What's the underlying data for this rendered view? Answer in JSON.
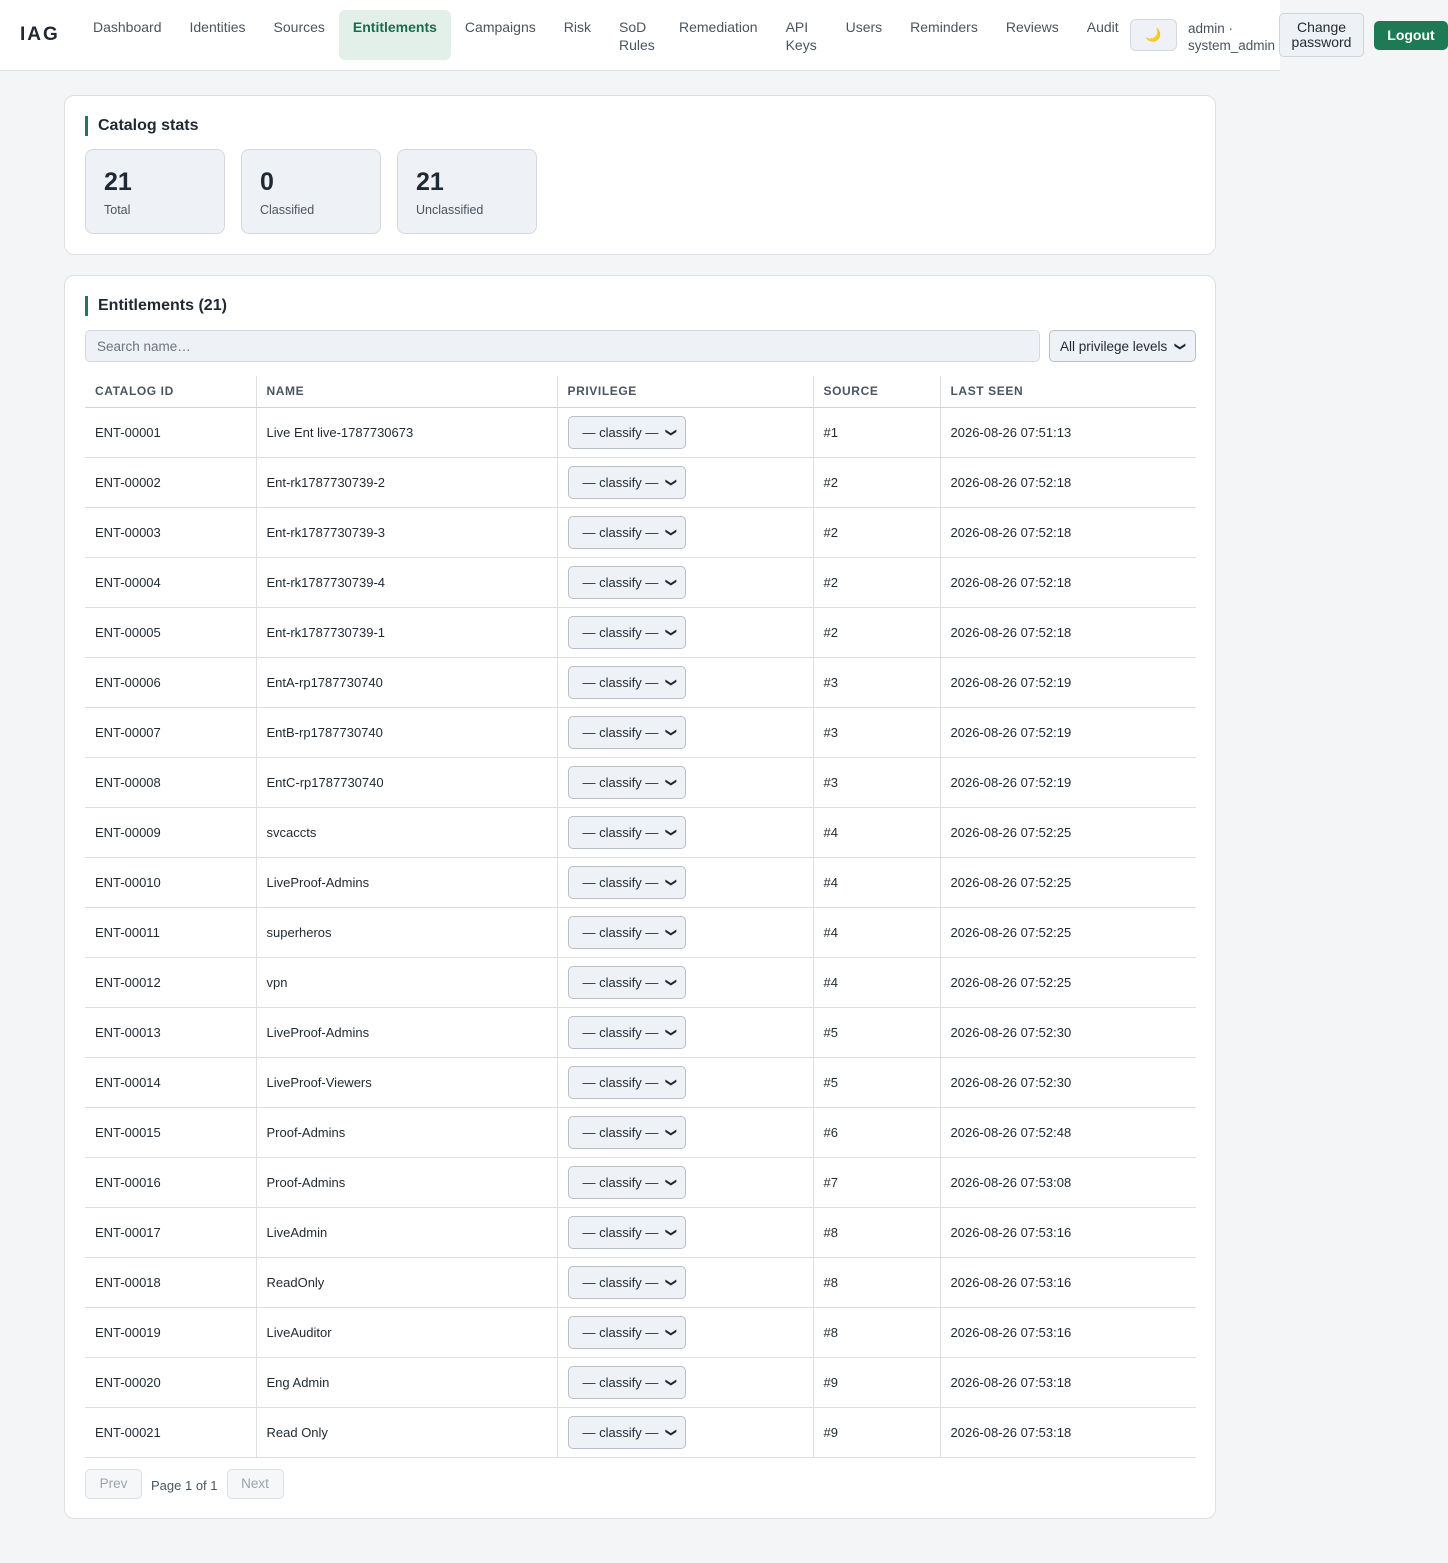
{
  "app": {
    "brand": "IAG"
  },
  "nav": [
    {
      "label": "Dashboard",
      "active": false
    },
    {
      "label": "Identities",
      "active": false
    },
    {
      "label": "Sources",
      "active": false
    },
    {
      "label": "Entitlements",
      "active": true
    },
    {
      "label": "Campaigns",
      "active": false
    },
    {
      "label": "Risk",
      "active": false
    },
    {
      "label": "SoD Rules",
      "active": false
    },
    {
      "label": "Remediation",
      "active": false
    },
    {
      "label": "API Keys",
      "active": false
    },
    {
      "label": "Users",
      "active": false
    },
    {
      "label": "Reminders",
      "active": false
    },
    {
      "label": "Reviews",
      "active": false
    },
    {
      "label": "Audit",
      "active": false
    }
  ],
  "header": {
    "theme_icon": "moon-icon",
    "theme_glyph": "🌙",
    "user": "admin · system_admin",
    "change_password": "Change password",
    "logout": "Logout"
  },
  "stats": {
    "title": "Catalog stats",
    "items": [
      {
        "value": "21",
        "label": "Total"
      },
      {
        "value": "0",
        "label": "Classified"
      },
      {
        "value": "21",
        "label": "Unclassified"
      }
    ]
  },
  "entitlements": {
    "title": "Entitlements (21)",
    "search_placeholder": "Search name…",
    "filter_value": "All privilege levels",
    "columns": [
      "CATALOG ID",
      "NAME",
      "PRIVILEGE",
      "SOURCE",
      "LAST SEEN"
    ],
    "rows": [
      {
        "id": "ENT-00001",
        "name": "Live Ent live-1787730673",
        "privilege": "— classify —",
        "source": "#1",
        "last_seen": "2026-08-26 07:51:13"
      },
      {
        "id": "ENT-00002",
        "name": "Ent-rk1787730739-2",
        "privilege": "— classify —",
        "source": "#2",
        "last_seen": "2026-08-26 07:52:18"
      },
      {
        "id": "ENT-00003",
        "name": "Ent-rk1787730739-3",
        "privilege": "— classify —",
        "source": "#2",
        "last_seen": "2026-08-26 07:52:18"
      },
      {
        "id": "ENT-00004",
        "name": "Ent-rk1787730739-4",
        "privilege": "— classify —",
        "source": "#2",
        "last_seen": "2026-08-26 07:52:18"
      },
      {
        "id": "ENT-00005",
        "name": "Ent-rk1787730739-1",
        "privilege": "— classify —",
        "source": "#2",
        "last_seen": "2026-08-26 07:52:18"
      },
      {
        "id": "ENT-00006",
        "name": "EntA-rp1787730740",
        "privilege": "— classify —",
        "source": "#3",
        "last_seen": "2026-08-26 07:52:19"
      },
      {
        "id": "ENT-00007",
        "name": "EntB-rp1787730740",
        "privilege": "— classify —",
        "source": "#3",
        "last_seen": "2026-08-26 07:52:19"
      },
      {
        "id": "ENT-00008",
        "name": "EntC-rp1787730740",
        "privilege": "— classify —",
        "source": "#3",
        "last_seen": "2026-08-26 07:52:19"
      },
      {
        "id": "ENT-00009",
        "name": "svcaccts",
        "privilege": "— classify —",
        "source": "#4",
        "last_seen": "2026-08-26 07:52:25"
      },
      {
        "id": "ENT-00010",
        "name": "LiveProof-Admins",
        "privilege": "— classify —",
        "source": "#4",
        "last_seen": "2026-08-26 07:52:25"
      },
      {
        "id": "ENT-00011",
        "name": "superheros",
        "privilege": "— classify —",
        "source": "#4",
        "last_seen": "2026-08-26 07:52:25"
      },
      {
        "id": "ENT-00012",
        "name": "vpn",
        "privilege": "— classify —",
        "source": "#4",
        "last_seen": "2026-08-26 07:52:25"
      },
      {
        "id": "ENT-00013",
        "name": "LiveProof-Admins",
        "privilege": "— classify —",
        "source": "#5",
        "last_seen": "2026-08-26 07:52:30"
      },
      {
        "id": "ENT-00014",
        "name": "LiveProof-Viewers",
        "privilege": "— classify —",
        "source": "#5",
        "last_seen": "2026-08-26 07:52:30"
      },
      {
        "id": "ENT-00015",
        "name": "Proof-Admins",
        "privilege": "— classify —",
        "source": "#6",
        "last_seen": "2026-08-26 07:52:48"
      },
      {
        "id": "ENT-00016",
        "name": "Proof-Admins",
        "privilege": "— classify —",
        "source": "#7",
        "last_seen": "2026-08-26 07:53:08"
      },
      {
        "id": "ENT-00017",
        "name": "LiveAdmin",
        "privilege": "— classify —",
        "source": "#8",
        "last_seen": "2026-08-26 07:53:16"
      },
      {
        "id": "ENT-00018",
        "name": "ReadOnly",
        "privilege": "— classify —",
        "source": "#8",
        "last_seen": "2026-08-26 07:53:16"
      },
      {
        "id": "ENT-00019",
        "name": "LiveAuditor",
        "privilege": "— classify —",
        "source": "#8",
        "last_seen": "2026-08-26 07:53:16"
      },
      {
        "id": "ENT-00020",
        "name": "Eng Admin",
        "privilege": "— classify —",
        "source": "#9",
        "last_seen": "2026-08-26 07:53:18"
      },
      {
        "id": "ENT-00021",
        "name": "Read Only",
        "privilege": "— classify —",
        "source": "#9",
        "last_seen": "2026-08-26 07:53:18"
      }
    ],
    "pager": {
      "prev": "Prev",
      "info": "Page 1 of 1",
      "next": "Next"
    }
  },
  "colors": {
    "accent": "#1d7a55",
    "active_nav_bg": "#e3f0ea",
    "active_nav_text": "#1d6b4f"
  }
}
